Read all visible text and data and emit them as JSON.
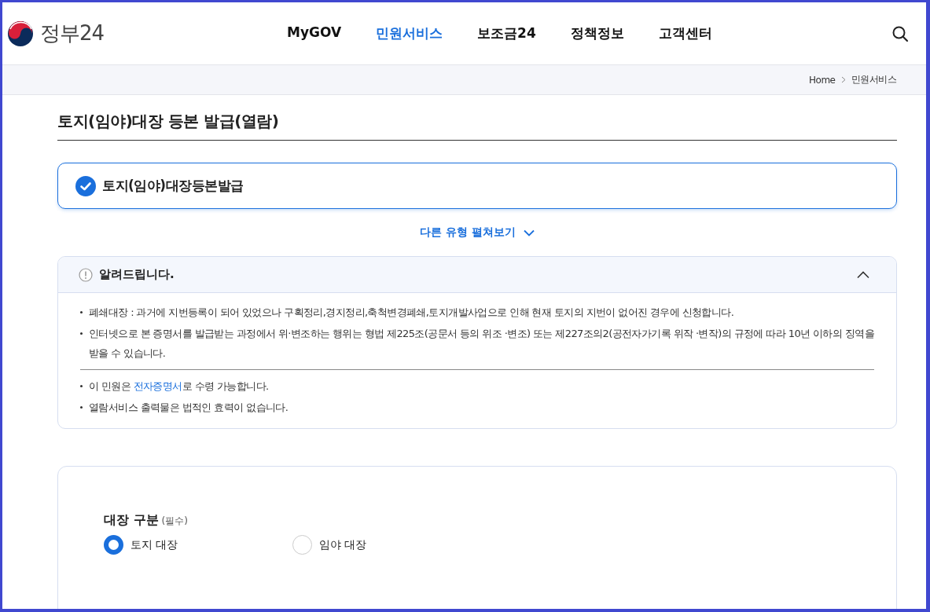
{
  "header": {
    "logo_text": "정부24",
    "nav": [
      {
        "label": "MyGOV",
        "selected": false
      },
      {
        "label": "민원서비스",
        "selected": true
      },
      {
        "label": "보조금24",
        "selected": false
      },
      {
        "label": "정책정보",
        "selected": false
      },
      {
        "label": "고객센터",
        "selected": false
      }
    ]
  },
  "breadcrumb": [
    "Home",
    "민원서비스"
  ],
  "page_title": "토지(임야)대장 등본 발급(열람)",
  "selected_service": {
    "label": "토지(임야)대장등본발급",
    "checked": true
  },
  "expand_link": "다른 유형 펼쳐보기",
  "notice": {
    "title": "알려드립니다.",
    "expanded": true,
    "groups": [
      [
        {
          "text": "폐쇄대장 : 과거에 지번등록이 되어 있었으나 구획정리,경지정리,축척변경폐쇄,토지개발사업으로 인해 현재 토지의 지번이 없어진 경우에 신청합니다."
        },
        {
          "text": "인터넷으로 본 증명서를 발급받는 과정에서 위·변조하는 행위는 형법 제225조(공문서 등의 위조 ·변조) 또는 제227조의2(공전자가기록 위작 ·변작)의 규정에 따라 10년 이하의 징역을 받을 수 있습니다."
        }
      ],
      [
        {
          "text": "이 민원은 ",
          "link": "전자증명서",
          "after": "로 수령 가능합니다."
        },
        {
          "text": "열람서비스 출력물은 법적인 효력이 없습니다."
        }
      ]
    ]
  },
  "form": {
    "field_label": "대장 구분",
    "required_note": "(필수)",
    "options": [
      {
        "label": "토지 대장",
        "selected": true
      },
      {
        "label": "임야 대장",
        "selected": false
      }
    ]
  }
}
